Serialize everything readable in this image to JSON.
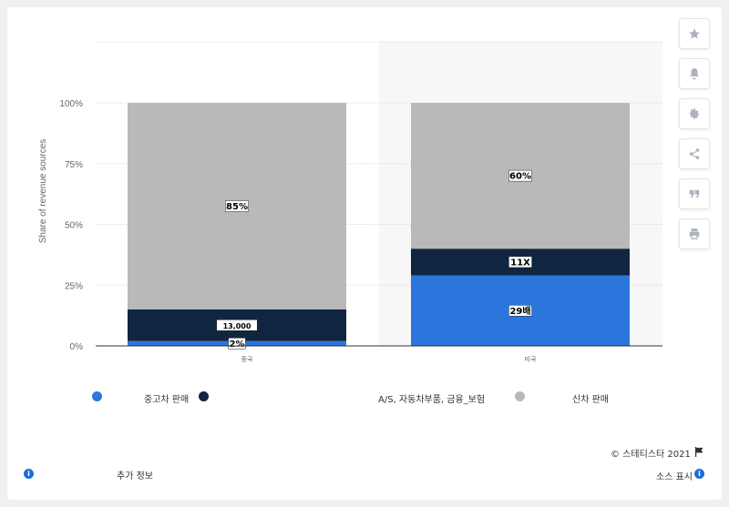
{
  "chart_data": {
    "type": "bar",
    "stacked": true,
    "categories": [
      "중국",
      "미국"
    ],
    "ylabel": "Share of revenue sources",
    "ylim": [
      0,
      100
    ],
    "yticks": [
      "0%",
      "25%",
      "50%",
      "75%",
      "100%"
    ],
    "grid": true,
    "series": [
      {
        "name": "중고차 판매",
        "color": "#2a76dd",
        "values": [
          2,
          29
        ],
        "labels": [
          "2%",
          "29배"
        ]
      },
      {
        "name": "A/S, 자동차부품, 금융_보험",
        "color": "#10253f",
        "values": [
          13,
          11
        ],
        "labels": [
          "13,000",
          "11X"
        ]
      },
      {
        "name": "신차 판매",
        "color": "#b9b9b9",
        "values": [
          85,
          60
        ],
        "labels": [
          "85%",
          "60%"
        ]
      }
    ]
  },
  "legend": {
    "items": [
      {
        "label": "중고차 판매",
        "color": "#2a76dd"
      },
      {
        "label": "A/S, 자동차부품, 금융_보험",
        "color": "#10253f"
      },
      {
        "label": "신차 판매",
        "color": "#b9b9b9"
      }
    ]
  },
  "toolbar": {
    "icons": [
      "star-icon",
      "bell-icon",
      "gear-icon",
      "share-icon",
      "quote-icon",
      "print-icon"
    ]
  },
  "footer": {
    "copyright": "© 스테티스타 2021",
    "more_info": "추가 정보",
    "source": "소스 표시"
  }
}
